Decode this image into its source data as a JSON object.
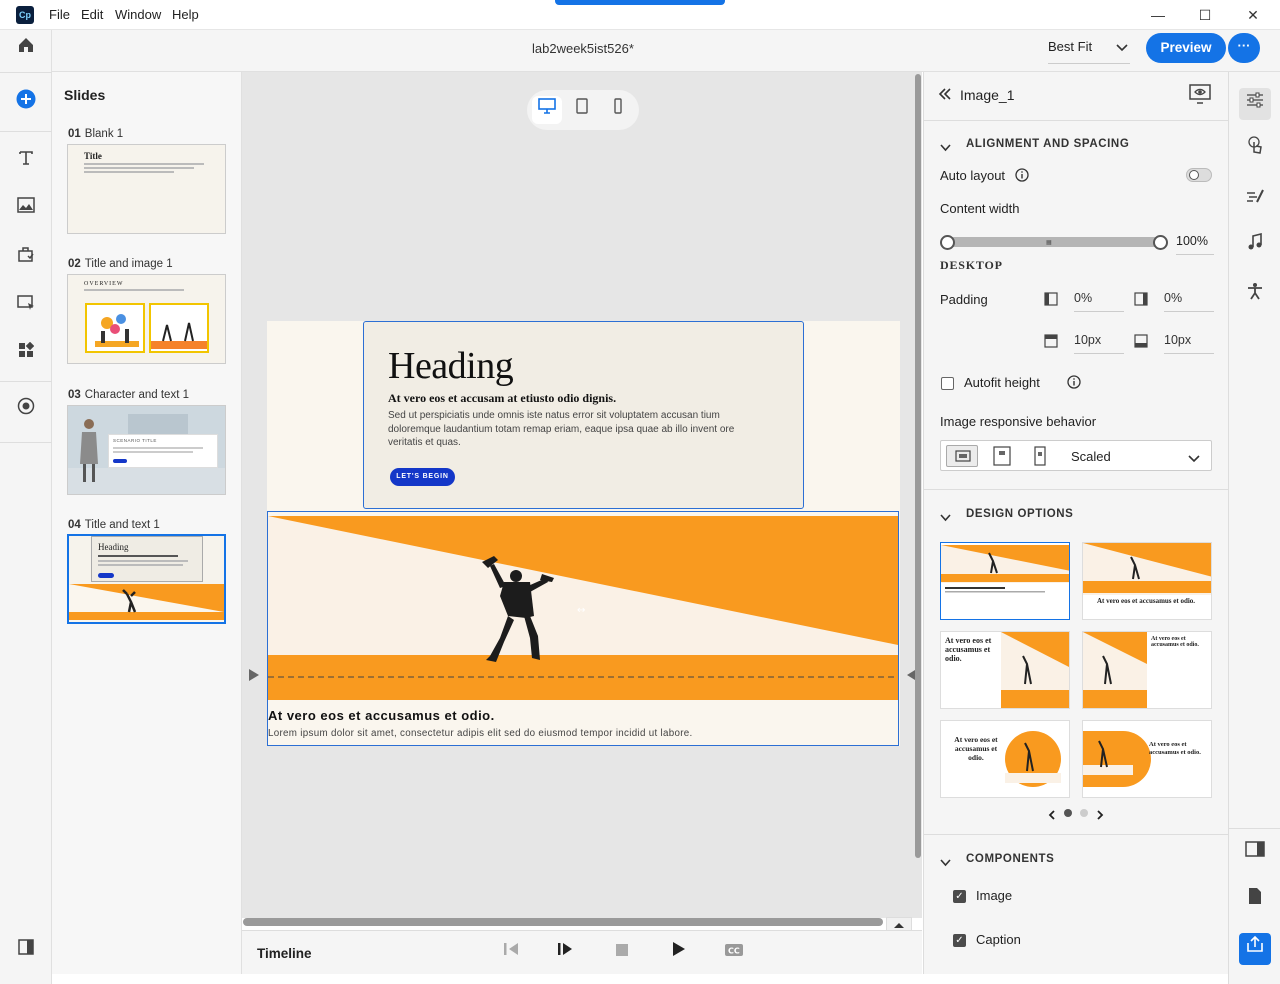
{
  "app": {
    "logo_text": "Cp",
    "menu": [
      "File",
      "Edit",
      "Window",
      "Help"
    ],
    "window_controls": [
      "—",
      "☐",
      "✕"
    ]
  },
  "header": {
    "doc_title": "lab2week5ist526*",
    "zoom": "Best Fit",
    "preview_label": "Preview",
    "more_label": "···"
  },
  "slides_panel": {
    "title": "Slides",
    "items": [
      {
        "num": "01",
        "label": "Blank 1",
        "thumb_title": "Title"
      },
      {
        "num": "02",
        "label": "Title and image 1",
        "thumb_title": "OVERVIEW"
      },
      {
        "num": "03",
        "label": "Character and text 1",
        "thumb_title": "SCENARIO TITLE"
      },
      {
        "num": "04",
        "label": "Title and text 1",
        "thumb_title": "Heading"
      }
    ]
  },
  "slide": {
    "heading": "Heading",
    "subheading": "At vero eos et accusam at etiusto odio dignis.",
    "body": "Sed ut perspiciatis unde omnis iste natus error sit voluptatem accusan tium doloremque laudantium totam remap eriam, eaque ipsa quae ab illo invent ore veritatis et quas.",
    "button": "LET'S BEGIN",
    "caption_title": "At vero eos et accusamus et odio.",
    "caption_text": "Lorem ipsum dolor sit amet, consectetur adipis elit sed do eiusmod tempor incidid ut labore."
  },
  "timeline": {
    "label": "Timeline"
  },
  "properties": {
    "object_name": "Image_1",
    "alignment_title": "ALIGNMENT AND SPACING",
    "auto_layout_label": "Auto layout",
    "auto_layout_on": false,
    "content_width_label": "Content width",
    "content_width_value": "100%",
    "device_label": "DESKTOP",
    "padding_label": "Padding",
    "padding_left": "0%",
    "padding_right": "0%",
    "padding_top": "10px",
    "padding_bottom": "10px",
    "autofit_label": "Autofit height",
    "responsive_label": "Image responsive behavior",
    "responsive_value": "Scaled",
    "design_title": "DESIGN OPTIONS",
    "design_tile_text": "At vero eos et accusamus et odio.",
    "components_title": "COMPONENTS",
    "components": [
      {
        "label": "Image",
        "checked": true
      },
      {
        "label": "Caption",
        "checked": true
      }
    ]
  },
  "colors": {
    "accent": "#1473e6",
    "orange": "#f99a1f",
    "cream": "#faf6ee",
    "button_blue": "#1437c8"
  }
}
